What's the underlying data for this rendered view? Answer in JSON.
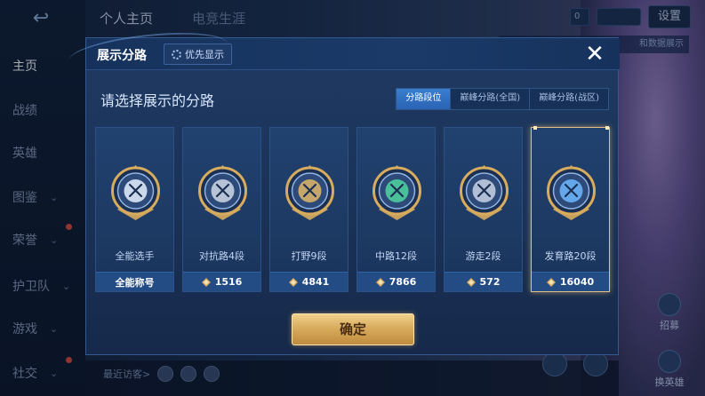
{
  "background": {
    "sidebar": [
      {
        "label": "主页",
        "active": true
      },
      {
        "label": "战绩"
      },
      {
        "label": "英雄"
      },
      {
        "label": "图鉴",
        "chevron": true
      },
      {
        "label": "荣誉",
        "chevron": true,
        "dot": true
      },
      {
        "label": "护卫队",
        "chevron": true
      },
      {
        "label": "游戏",
        "chevron": true
      },
      {
        "label": "社交",
        "chevron": true,
        "dot": true
      }
    ],
    "top_tabs": [
      "个人主页",
      "电竞生涯"
    ],
    "settings_label": "设置",
    "coin_label": "0",
    "promo_text": "和数据展示",
    "visitor_label": "最近访客>",
    "right_btns": [
      "招募",
      "换英雄"
    ]
  },
  "modal": {
    "title": "展示分路",
    "priority_label": "优先显示",
    "subtitle": "请选择展示的分路",
    "tabs": [
      {
        "label": "分路段位",
        "active": true
      },
      {
        "label": "巅峰分路(全国)"
      },
      {
        "label": "巅峰分路(战区)"
      }
    ],
    "cards": [
      {
        "name": "全能选手",
        "footer": "全能称号",
        "score": null,
        "icon": "all-round-badge-icon",
        "selected": false,
        "tint": "#e8f0ff"
      },
      {
        "name": "对抗路4段",
        "footer": null,
        "score": "1516",
        "icon": "clash-lane-badge-icon",
        "selected": false,
        "tint": "#cfd8e8"
      },
      {
        "name": "打野9段",
        "footer": null,
        "score": "4841",
        "icon": "jungle-badge-icon",
        "selected": false,
        "tint": "#e0b66a"
      },
      {
        "name": "中路12段",
        "footer": null,
        "score": "7866",
        "icon": "mid-lane-badge-icon",
        "selected": false,
        "tint": "#4fd3a0"
      },
      {
        "name": "游走2段",
        "footer": null,
        "score": "572",
        "icon": "roam-badge-icon",
        "selected": false,
        "tint": "#c9d4e6"
      },
      {
        "name": "发育路20段",
        "footer": null,
        "score": "16040",
        "icon": "farm-lane-badge-icon",
        "selected": true,
        "tint": "#6fb8ff"
      }
    ],
    "confirm_label": "确定",
    "close_icon": "close-icon",
    "gold": "#d8ac5e",
    "accent": "#3a7ed0"
  }
}
